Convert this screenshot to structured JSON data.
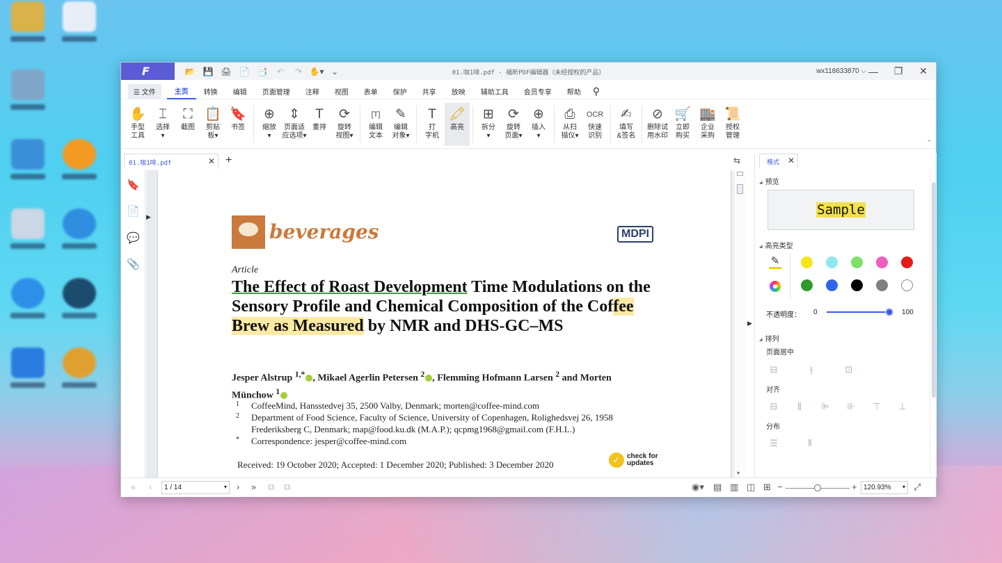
{
  "app": {
    "title": "01.咖1啡.pdf - 福昕PDF编辑器（未经授权的产品）",
    "user": "wx118633870",
    "user_chevron": "⌵",
    "logo_glyph": "F"
  },
  "quick_access": [
    "📂",
    "💾",
    "🖨",
    "📄",
    "📑",
    "↶",
    "↷",
    "✋▾",
    "⌄"
  ],
  "window_controls": {
    "minimize": "—",
    "restore": "❐",
    "close": "✕"
  },
  "menu": {
    "file": "☰ 文件",
    "items": [
      "主页",
      "转换",
      "编辑",
      "页面管理",
      "注释",
      "视图",
      "表单",
      "保护",
      "共享",
      "放映",
      "辅助工具",
      "会员专享",
      "帮助"
    ],
    "search_icon": "⚲"
  },
  "ribbon": {
    "groups": [
      [
        {
          "icon": "✋",
          "label": "手型\n工具"
        },
        {
          "icon": "⌶",
          "label": "选择\n▾"
        },
        {
          "icon": "⛶",
          "label": "截图"
        },
        {
          "icon": "📋",
          "label": "剪贴\n板▾"
        },
        {
          "icon": "🔖",
          "label": "书签"
        }
      ],
      [
        {
          "icon": "⊕",
          "label": "缩放\n▾"
        },
        {
          "icon": "⇕",
          "label": "页面适\n应选项▾"
        },
        {
          "icon": "T",
          "label": "重排"
        },
        {
          "icon": "⟳",
          "label": "旋转\n视图▾"
        }
      ],
      [
        {
          "icon": "[T]",
          "label": "编辑\n文本"
        },
        {
          "icon": "✎",
          "label": "编辑\n对象▾"
        }
      ],
      [
        {
          "icon": "T",
          "label": "打\n字机"
        },
        {
          "icon": "🖍",
          "label": "高亮",
          "active": true
        }
      ],
      [
        {
          "icon": "⊞",
          "label": "拆分\n▾"
        },
        {
          "icon": "⟳",
          "label": "旋转\n页面▾"
        },
        {
          "icon": "⊕",
          "label": "插入\n▾"
        }
      ],
      [
        {
          "icon": "⎙",
          "label": "从扫\n描仪▾"
        },
        {
          "icon": "OCR",
          "label": "快速\n识别"
        }
      ],
      [
        {
          "icon": "✍",
          "label": "填写\n&签名"
        }
      ],
      [
        {
          "icon": "⊘",
          "label": "删除试\n用水印"
        },
        {
          "icon": "🛒",
          "label": "立即\n购买"
        },
        {
          "icon": "🏬",
          "label": "企业\n采购"
        },
        {
          "icon": "📜",
          "label": "授权\n管理"
        }
      ]
    ],
    "collapse_icon": "⌃"
  },
  "tabs": {
    "doc_tab": "01.咖1啡.pdf",
    "close": "✕",
    "add": "+",
    "panel_toggle": "⇆"
  },
  "leftbar": {
    "icons": [
      "🔖",
      "📄",
      "💬",
      "📎"
    ],
    "expand_arrow": "▶"
  },
  "document": {
    "journal": "beverages",
    "publisher": "MDPI",
    "article_type": "Article",
    "title_underlined": "The Effect of Roast Development",
    "title_part2": " Time Modulations on the Sensory Profile and Chemical Composition of the Cof",
    "title_highlight": "fee Brew as Measured",
    "title_part3": " by NMR and DHS-GC–MS",
    "authors_line1": "Jesper Alstrup ",
    "authors_sup1": "1,*",
    "authors_line2": ", Mikael Agerlin Petersen ",
    "authors_sup2": "2",
    "authors_line3": ", Flemming Hofmann Larsen ",
    "authors_sup3": "2",
    "authors_line4": " and Morten Münchow ",
    "authors_sup4": "1",
    "affiliations": [
      {
        "num": "1",
        "text": "CoffeeMind, Hansstedvej 35, 2500 Valby, Denmark; morten@coffee-mind.com"
      },
      {
        "num": "2",
        "text": "Department of Food Science, Faculty of Science, University of Copenhagen, Rolighedsvej 26, 1958 Frederiksberg C, Denmark; map@food.ku.dk (M.A.P.); qcpmg1968@gmail.com (F.H.L.)"
      },
      {
        "num": "*",
        "text": "Correspondence: jesper@coffee-mind.com"
      }
    ],
    "received": "Received: 19 October 2020; Accepted: 1 December 2020; Published: 3 December 2020",
    "check_updates_1": "check for",
    "check_updates_2": "updates"
  },
  "right_panel": {
    "tab": "格式",
    "close": "✕",
    "preview_heading": "预览",
    "preview_sample": "Sample",
    "highlight_type_heading": "高亮类型",
    "swatches_row1": [
      "#f5e61a",
      "#8fe7f0",
      "#7ee06a",
      "#ec5fbd",
      "#e8191a"
    ],
    "swatches_row2": [
      "#2e9a2b",
      "#2f65e8",
      "#000000",
      "#7f7f7f",
      "#ffffff"
    ],
    "opacity_label": "不透明度：",
    "opacity_min": "0",
    "opacity_max": "100",
    "opacity_value": 100,
    "arrange_heading": "排列",
    "page_center": "页面居中",
    "align": "对齐",
    "distribute": "分布"
  },
  "statusbar": {
    "page_display": "1 / 14",
    "zoom": "120.93%",
    "zoom_fraction": 0.5
  }
}
